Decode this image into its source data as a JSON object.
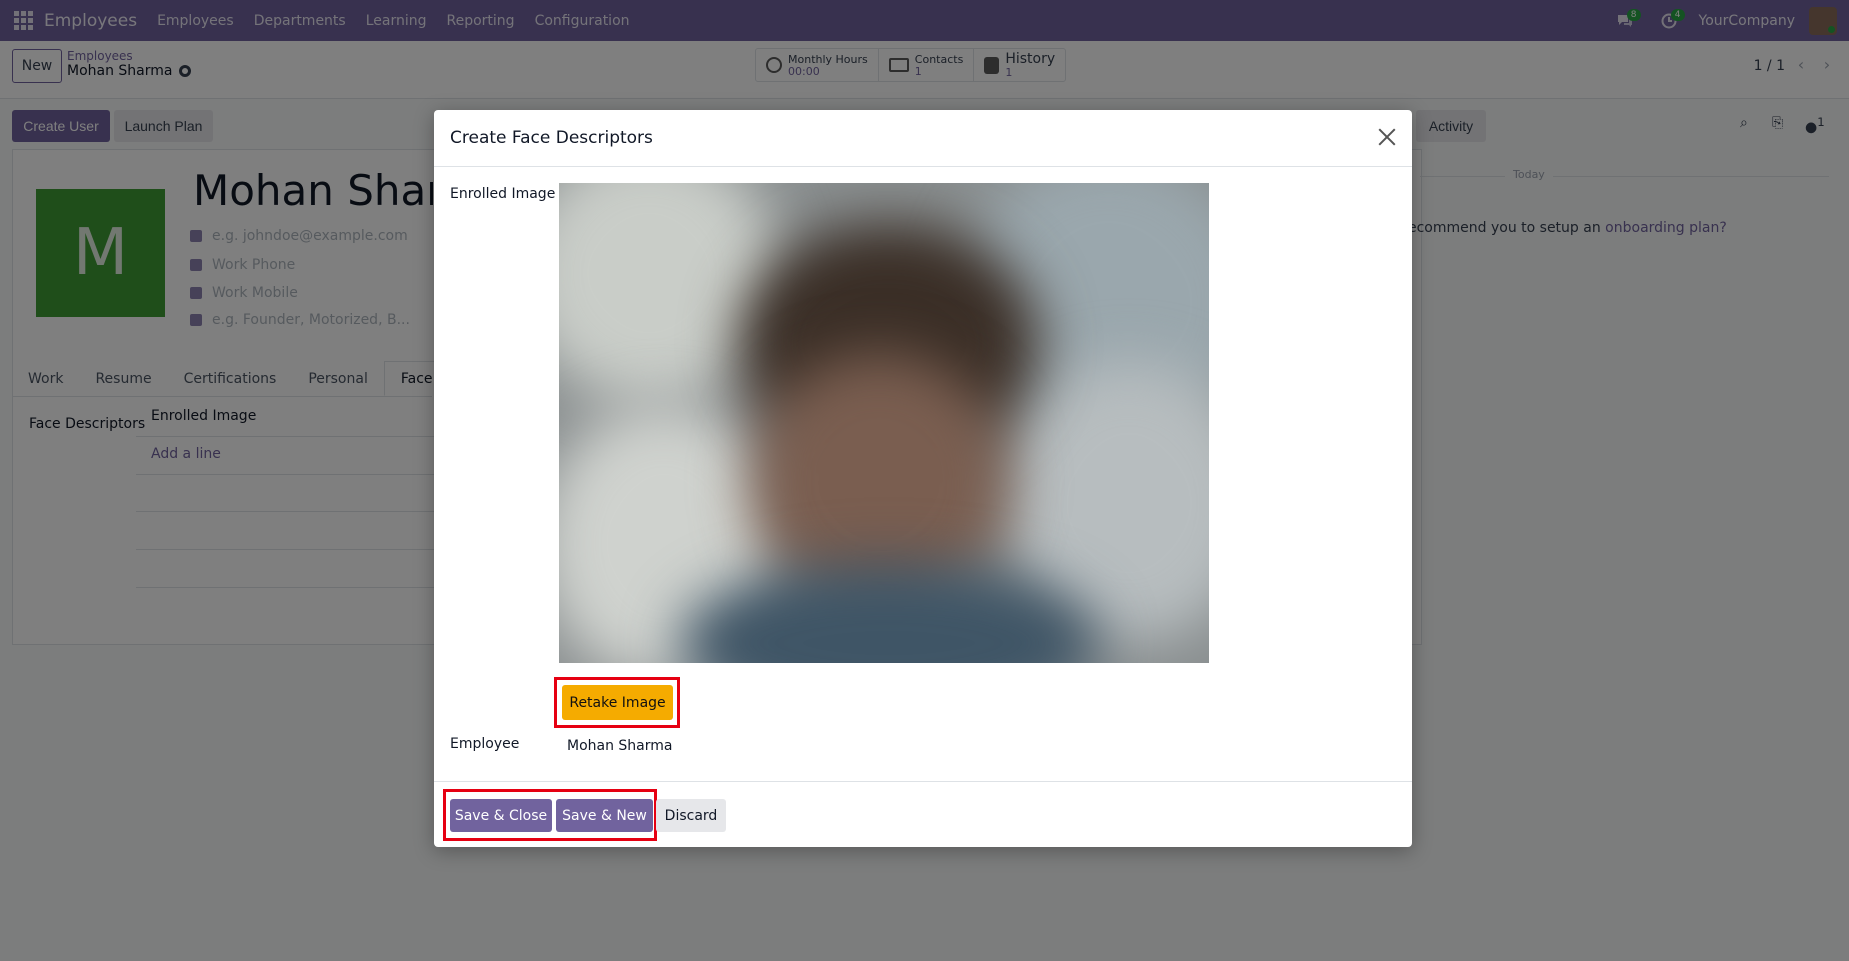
{
  "navbar": {
    "app_name": "Employees",
    "menu": [
      "Employees",
      "Departments",
      "Learning",
      "Reporting",
      "Configuration"
    ],
    "messages_badge": "8",
    "activities_badge": "4",
    "company": "YourCompany"
  },
  "control": {
    "new_label": "New",
    "breadcrumb_parent": "Employees",
    "breadcrumb_current": "Mohan Sharma",
    "smart_buttons": [
      {
        "title": "Monthly Hours",
        "value": "00:00"
      },
      {
        "title": "Contacts",
        "value": "1"
      },
      {
        "title": "History",
        "value": "1"
      }
    ],
    "pager": "1 / 1"
  },
  "form": {
    "create_user": "Create User",
    "launch_plan": "Launch Plan",
    "activity": "Activity",
    "employee_name": "Mohan Sharma",
    "avatar_letter": "M",
    "email_placeholder": "e.g. johndoe@example.com",
    "work_phone_placeholder": "Work Phone",
    "work_mobile_placeholder": "Work Mobile",
    "tags_placeholder": "e.g. Founder, Motorized, B...",
    "tabs": [
      "Work",
      "Resume",
      "Certifications",
      "Personal",
      "Face"
    ],
    "face_descriptors_label": "Face Descriptors",
    "enrolled_image_col": "Enrolled Image",
    "add_line": "Add a line",
    "today": "Today",
    "onboarding_text": "ecommend you to setup an ",
    "onboarding_link": "onboarding plan?",
    "followers_count": "1"
  },
  "modal": {
    "title": "Create Face Descriptors",
    "enrolled_image_label": "Enrolled Image",
    "retake_label": "Retake Image",
    "employee_label": "Employee",
    "employee_value": "Mohan Sharma",
    "save_close": "Save & Close",
    "save_new": "Save & New",
    "discard": "Discard"
  },
  "colors": {
    "brand": "#71639e",
    "retake": "#f5ab00",
    "highlight": "#e60012",
    "avatar": "#3f9c35"
  }
}
